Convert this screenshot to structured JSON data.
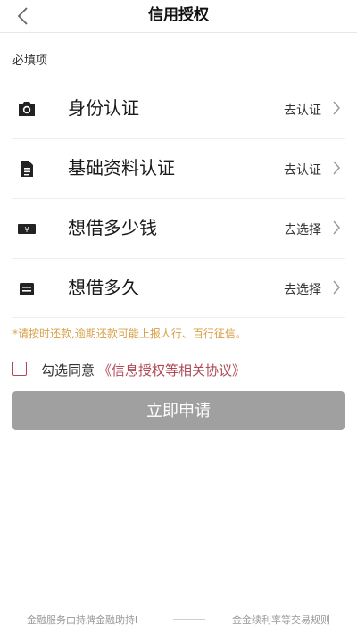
{
  "nav": {
    "title": "信用授权",
    "back_icon": "chevron-left-icon"
  },
  "section_label": "必填项",
  "items": [
    {
      "label": "身份认证",
      "action": "去认证",
      "icon": "camera-icon"
    },
    {
      "label": "基础资料认证",
      "action": "去认证",
      "icon": "document-icon"
    },
    {
      "label": "想借多少钱",
      "action": "去选择",
      "icon": "money-icon"
    },
    {
      "label": "想借多久",
      "action": "去选择",
      "icon": "calendar-icon"
    }
  ],
  "notice": "*请按时还款,逾期还款可能上报人行、百行征信。",
  "agreement": {
    "prefix": "勾选同意",
    "link": "《信息授权等相关协议》",
    "checked": false
  },
  "apply_button": "立即申请",
  "footer": {
    "left": "金融服务由持牌金融助持l",
    "right": "金金续利率等交易规则"
  },
  "colors": {
    "accent": "#b04855",
    "notice": "#d7a24a",
    "button_disabled": "#a0a0a0"
  }
}
